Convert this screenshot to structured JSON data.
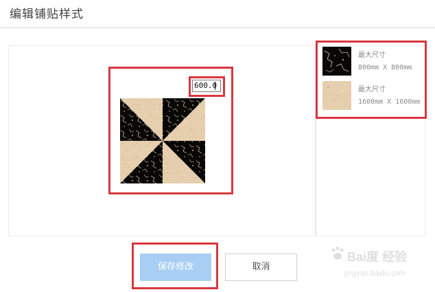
{
  "dialog": {
    "title": "编辑铺贴样式"
  },
  "editor": {
    "size_value": "600.0"
  },
  "materials": [
    {
      "name": "最大尺寸",
      "size": "800mm X 800mm",
      "swatch": "black-marble",
      "color": "#0a0806"
    },
    {
      "name": "最大尺寸",
      "size": "1600mm X 1600mm",
      "swatch": "beige-marble",
      "color": "#e6cfae"
    }
  ],
  "actions": {
    "save_label": "保存修改",
    "cancel_label": "取消"
  },
  "colors": {
    "highlight": "#d9373f",
    "save_button": "#a8cff3"
  },
  "watermark": {
    "brand": "Bai度 经验",
    "url": "jingyan.baidu.com"
  }
}
